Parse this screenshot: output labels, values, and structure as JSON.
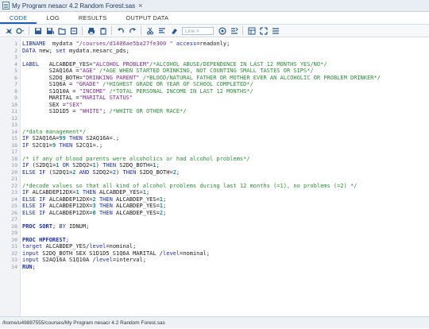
{
  "window": {
    "title": "My Program nesacr 4.2 Random Forest.sas",
    "close_glyph": "×"
  },
  "tabs": [
    {
      "label": "CODE",
      "active": true
    },
    {
      "label": "LOG",
      "active": false
    },
    {
      "label": "RESULTS",
      "active": false
    },
    {
      "label": "OUTPUT DATA",
      "active": false
    }
  ],
  "toolbar": {
    "line_placeholder": "Line #"
  },
  "code_lines": [
    {
      "n": "1",
      "segs": [
        [
          "kw2",
          "LIBNAME"
        ],
        [
          "",
          "  mydata "
        ],
        [
          "str",
          "\"/courses/d1406ae5ba27fe300 \""
        ],
        [
          "",
          ""
        ],
        [
          "kw2",
          " access"
        ],
        [
          "",
          "=readonly;"
        ]
      ]
    },
    {
      "n": "2",
      "segs": [
        [
          "kw2",
          "DATA"
        ],
        [
          "",
          " new; "
        ],
        [
          "kw2",
          "set"
        ],
        [
          "",
          " mydata.nesarc_pds;"
        ]
      ]
    },
    {
      "n": "3",
      "segs": []
    },
    {
      "n": "4",
      "segs": [
        [
          "kw2",
          "LABEL"
        ],
        [
          "",
          "   ALCABDEP_YES="
        ],
        [
          "str",
          "\"ALCOHOL PROBLEM\""
        ],
        [
          "cmt",
          "/*ALCOHOL ABUSE/DEPENDENCE IN LAST 12 MONTHS YES/NO*/"
        ]
      ]
    },
    {
      "n": "5",
      "segs": [
        [
          "",
          "        S2AQ16A ="
        ],
        [
          "str",
          "\"AGE\""
        ],
        [
          "cmt",
          " /*AGE WHEN STARTED DRINKING, NOT COUNTING SMALL TASTES OR SIPS*/"
        ]
      ]
    },
    {
      "n": "6",
      "segs": [
        [
          "",
          "        S2DQ_BOTH="
        ],
        [
          "str",
          "\"DRINKING PARENT\""
        ],
        [
          "cmt",
          " /*BLOOD/NATURAL FATHER OR MOTHER EVER AN ALCOHOLIC OR PROBLEM DRINKER*/"
        ]
      ]
    },
    {
      "n": "7",
      "segs": [
        [
          "",
          "        S1Q6A = "
        ],
        [
          "str",
          "\"GRADE\""
        ],
        [
          "cmt",
          " /*HIGHEST GRADE OR YEAR OF SCHOOL COMPLETED*/"
        ]
      ]
    },
    {
      "n": "8",
      "segs": [
        [
          "",
          "        S1Q10A = "
        ],
        [
          "str",
          "\"INCOME\""
        ],
        [
          "cmt",
          " /*TOTAL PERSONAL INCOME IN LAST 12 MONTHS*/"
        ]
      ]
    },
    {
      "n": "9",
      "segs": [
        [
          "",
          "        MARITAL ="
        ],
        [
          "str",
          "\"MARITAL STATUS\""
        ]
      ]
    },
    {
      "n": "10",
      "segs": [
        [
          "",
          "        SEX ="
        ],
        [
          "str",
          "\"SEX\""
        ]
      ]
    },
    {
      "n": "11",
      "segs": [
        [
          "",
          "        S1D1D5 = "
        ],
        [
          "str",
          "\"WHITE\""
        ],
        [
          ";",
          " "
        ],
        [
          "cmt",
          "/*WHITE OR OTHER RACE*/"
        ]
      ]
    },
    {
      "n": "12",
      "segs": []
    },
    {
      "n": "13",
      "segs": []
    },
    {
      "n": "14",
      "segs": [
        [
          "cmt",
          "/*data management*/"
        ]
      ]
    },
    {
      "n": "15",
      "segs": [
        [
          "kw2",
          "IF"
        ],
        [
          "",
          " S2AQ16A="
        ],
        [
          "num",
          "99"
        ],
        [
          "kw2",
          " THEN"
        ],
        [
          "",
          " S2AQ16A=.;"
        ]
      ]
    },
    {
      "n": "16",
      "segs": [
        [
          "kw2",
          "IF"
        ],
        [
          "",
          " S2CQ1="
        ],
        [
          "num",
          "9"
        ],
        [
          "kw2",
          " THEN"
        ],
        [
          "",
          " S2CQ1=.;"
        ]
      ]
    },
    {
      "n": "17",
      "segs": []
    },
    {
      "n": "18",
      "segs": [
        [
          "cmt",
          "/* if any of blood parents were alcoholics or had alcohol problems*/"
        ]
      ]
    },
    {
      "n": "19",
      "segs": [
        [
          "kw2",
          "IF"
        ],
        [
          "",
          " (S2DQ1="
        ],
        [
          "num",
          "1"
        ],
        [
          "kw2",
          " OR"
        ],
        [
          "",
          " S2DQ2="
        ],
        [
          "num",
          "1"
        ],
        [
          "",
          ")"
        ],
        [
          "kw2",
          " THEN"
        ],
        [
          "",
          " S2DQ_BOTH="
        ],
        [
          "num",
          "1"
        ],
        [
          "",
          ";"
        ]
      ]
    },
    {
      "n": "20",
      "segs": [
        [
          "kw2",
          "ELSE IF"
        ],
        [
          "",
          " (S2DQ1="
        ],
        [
          "num",
          "2"
        ],
        [
          "kw2",
          " AND"
        ],
        [
          "",
          " S2DQ2="
        ],
        [
          "num",
          "2"
        ],
        [
          "",
          ")"
        ],
        [
          "kw2",
          " THEN"
        ],
        [
          "",
          " S2DQ_BOTH="
        ],
        [
          "num",
          "2"
        ],
        [
          "",
          ";"
        ]
      ]
    },
    {
      "n": "21",
      "segs": []
    },
    {
      "n": "22",
      "segs": [
        [
          "cmt",
          "/*decode values so that all kind of alcohol problems during last 12 months (=1), no problems (=2) */"
        ]
      ]
    },
    {
      "n": "23",
      "segs": [
        [
          "kw2",
          "IF"
        ],
        [
          "",
          " ALCABDEP12DX="
        ],
        [
          "num",
          "1"
        ],
        [
          "kw2",
          " THEN"
        ],
        [
          "",
          " ALCABDEP_YES="
        ],
        [
          "num",
          "1"
        ],
        [
          "",
          ";"
        ]
      ]
    },
    {
      "n": "24",
      "segs": [
        [
          "kw2",
          "ELSE IF"
        ],
        [
          "",
          " ALCABDEP12DX="
        ],
        [
          "num",
          "2"
        ],
        [
          "kw2",
          " THEN"
        ],
        [
          "",
          " ALCABDEP_YES="
        ],
        [
          "num",
          "1"
        ],
        [
          "",
          ";"
        ]
      ]
    },
    {
      "n": "25",
      "segs": [
        [
          "kw2",
          "ELSE IF"
        ],
        [
          "",
          " ALCABDEP12DX="
        ],
        [
          "num",
          "3"
        ],
        [
          "kw2",
          " THEN"
        ],
        [
          "",
          " ALCABDEP_YES="
        ],
        [
          "num",
          "1"
        ],
        [
          "",
          ";"
        ]
      ]
    },
    {
      "n": "26",
      "segs": [
        [
          "kw2",
          "ELSE IF"
        ],
        [
          "",
          " ALCABDEP12DX="
        ],
        [
          "num",
          "0"
        ],
        [
          "kw2",
          " THEN"
        ],
        [
          "",
          " ALCABDEP_YES="
        ],
        [
          "num",
          "2"
        ],
        [
          "",
          ";"
        ]
      ]
    },
    {
      "n": "27",
      "segs": []
    },
    {
      "n": "28",
      "segs": [
        [
          "kw",
          "PROC SORT"
        ],
        [
          "",
          "; "
        ],
        [
          "kw2",
          "BY"
        ],
        [
          "",
          " IDNUM;"
        ]
      ]
    },
    {
      "n": "29",
      "segs": []
    },
    {
      "n": "30",
      "segs": [
        [
          "kw",
          "PROC HPFOREST"
        ],
        [
          "",
          ";"
        ]
      ]
    },
    {
      "n": "31",
      "segs": [
        [
          "kw2",
          "target"
        ],
        [
          "",
          " ALCABDEP_YES/"
        ],
        [
          "kw2",
          "level"
        ],
        [
          "",
          "=nominal;"
        ]
      ]
    },
    {
      "n": "32",
      "segs": [
        [
          "kw2",
          "input"
        ],
        [
          "",
          " S2DQ_BOTH SEX S1D1D5 S1Q6A MARITAL /"
        ],
        [
          "kw2",
          "level"
        ],
        [
          "",
          "=nominal;"
        ]
      ]
    },
    {
      "n": "33",
      "segs": [
        [
          "kw2",
          "input"
        ],
        [
          "",
          " S2AQ16A S1Q10A /"
        ],
        [
          "kw2",
          "level"
        ],
        [
          "",
          "=interval;"
        ]
      ]
    },
    {
      "n": "34",
      "segs": [
        [
          "kw",
          "RUN"
        ],
        [
          "",
          ";"
        ]
      ]
    }
  ],
  "status": {
    "path": "/home/u49887555/courses/My Program nesacr 4.2 Random Forest.sas"
  },
  "colors": {
    "accent": "#1b5fb0",
    "keyword": "#1b2fa8",
    "string": "#7a2d91",
    "comment": "#2e8b3a",
    "number": "#1a8a8a"
  }
}
